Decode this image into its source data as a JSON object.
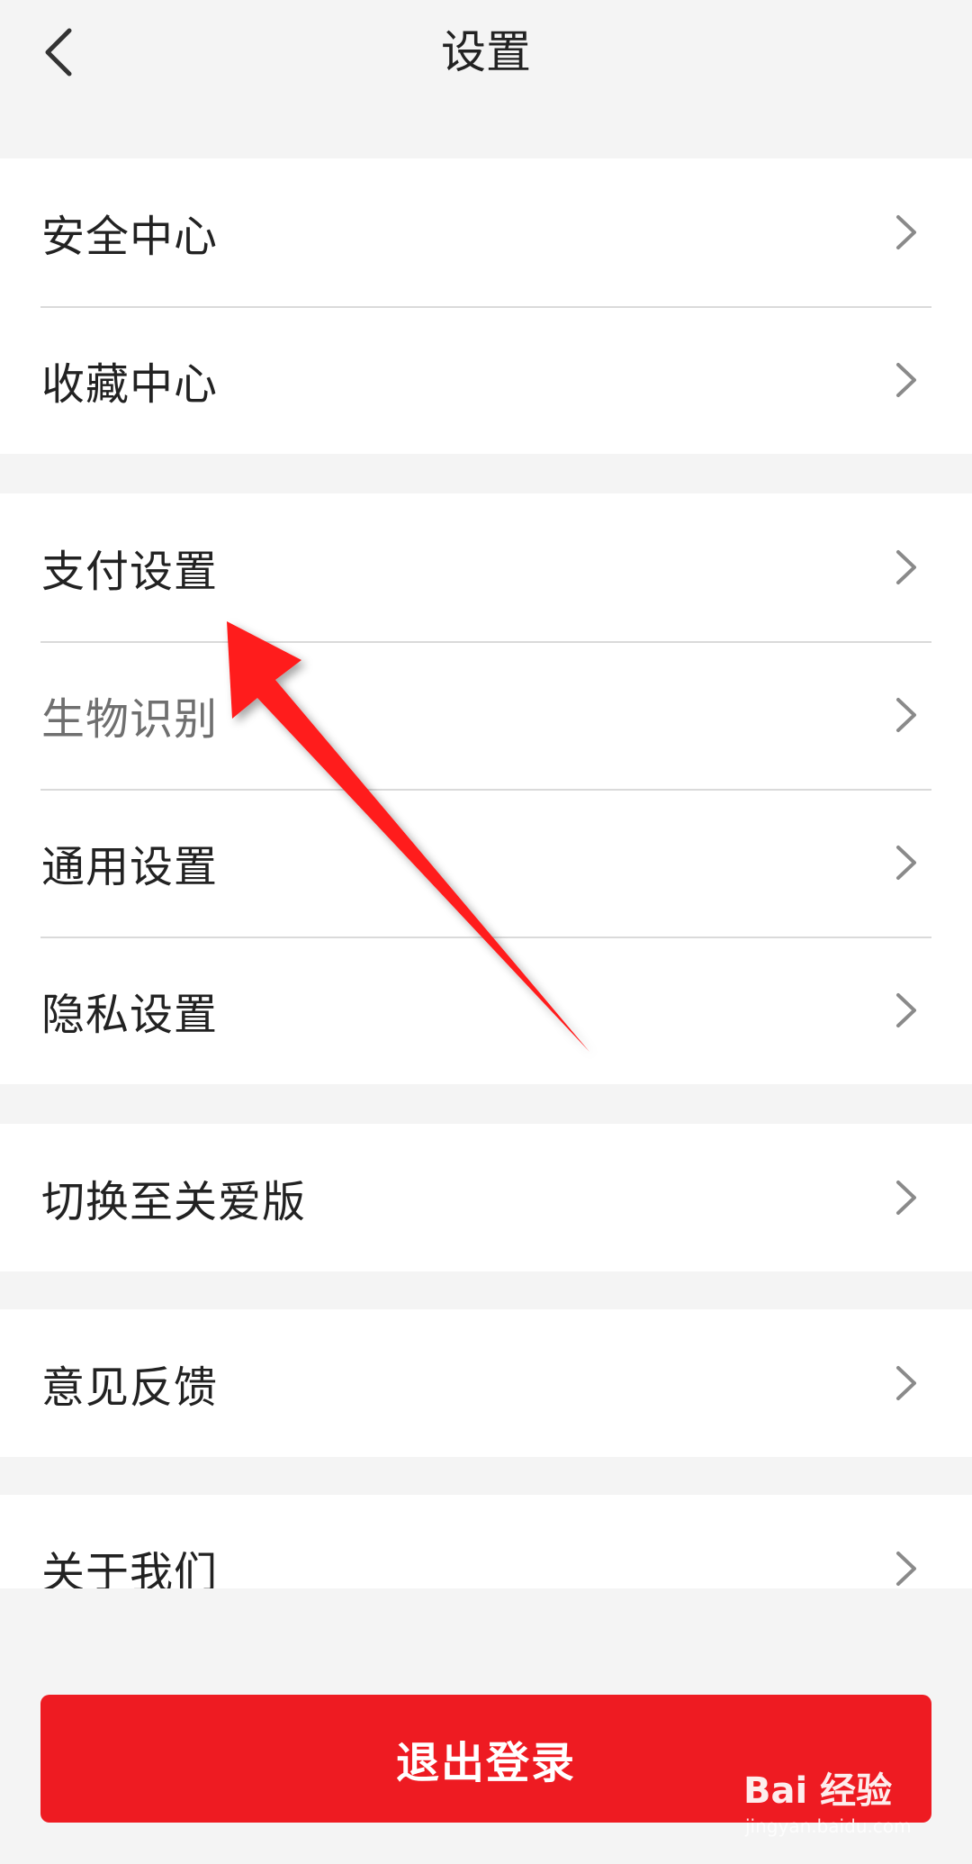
{
  "header": {
    "title": "设置"
  },
  "groups": [
    {
      "items": [
        {
          "label": "安全中心"
        },
        {
          "label": "收藏中心"
        }
      ]
    },
    {
      "items": [
        {
          "label": "支付设置"
        },
        {
          "label": "生物识别"
        },
        {
          "label": "通用设置"
        },
        {
          "label": "隐私设置"
        }
      ]
    },
    {
      "items": [
        {
          "label": "切换至关爱版"
        }
      ]
    },
    {
      "items": [
        {
          "label": "意见反馈"
        }
      ]
    },
    {
      "items": [
        {
          "label": "关于我们"
        }
      ]
    }
  ],
  "logout": {
    "label": "退出登录"
  },
  "watermark": {
    "brand": "Bai 经验",
    "url": "jingyan.baidu.com"
  },
  "colors": {
    "background": "#f4f4f4",
    "accent_red": "#ee1b22",
    "annotation_arrow": "#ff1a1a"
  }
}
